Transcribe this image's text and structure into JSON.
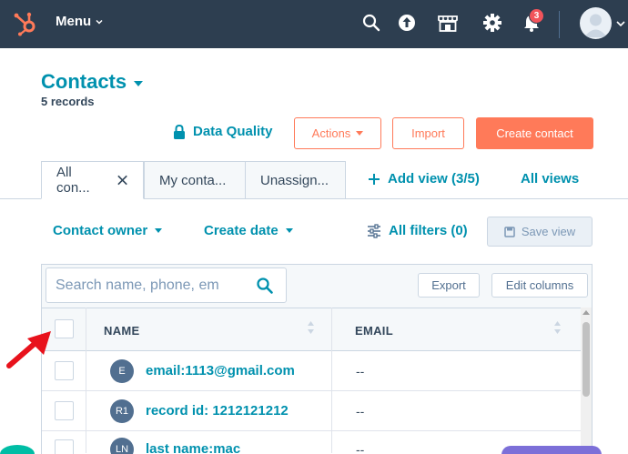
{
  "nav": {
    "menu_label": "Menu",
    "notification_count": "3"
  },
  "header": {
    "title": "Contacts",
    "records": "5 records",
    "data_quality": "Data Quality",
    "actions": "Actions",
    "import": "Import",
    "create_contact": "Create contact"
  },
  "tabs": [
    {
      "label": "All con..."
    },
    {
      "label": "My conta..."
    },
    {
      "label": "Unassign..."
    }
  ],
  "add_view": "Add view (3/5)",
  "all_views": "All views",
  "filters": {
    "contact_owner": "Contact owner",
    "create_date": "Create date",
    "all_filters": "All filters (0)",
    "save_view": "Save view"
  },
  "table": {
    "search_placeholder": "Search name, phone, em",
    "export": "Export",
    "edit_columns": "Edit columns",
    "columns": [
      "NAME",
      "EMAIL"
    ],
    "rows": [
      {
        "initials": "E",
        "name": "email:1113@gmail.com",
        "email": "--"
      },
      {
        "initials": "R1",
        "name": "record id: 1212121212",
        "email": "--"
      },
      {
        "initials": "LN",
        "name": "last name:mac",
        "email": "--"
      }
    ]
  },
  "colors": {
    "nav_bg": "#2d3e50",
    "link": "#0091ae",
    "accent": "#ff7a59",
    "arrow": "#e8121c"
  }
}
